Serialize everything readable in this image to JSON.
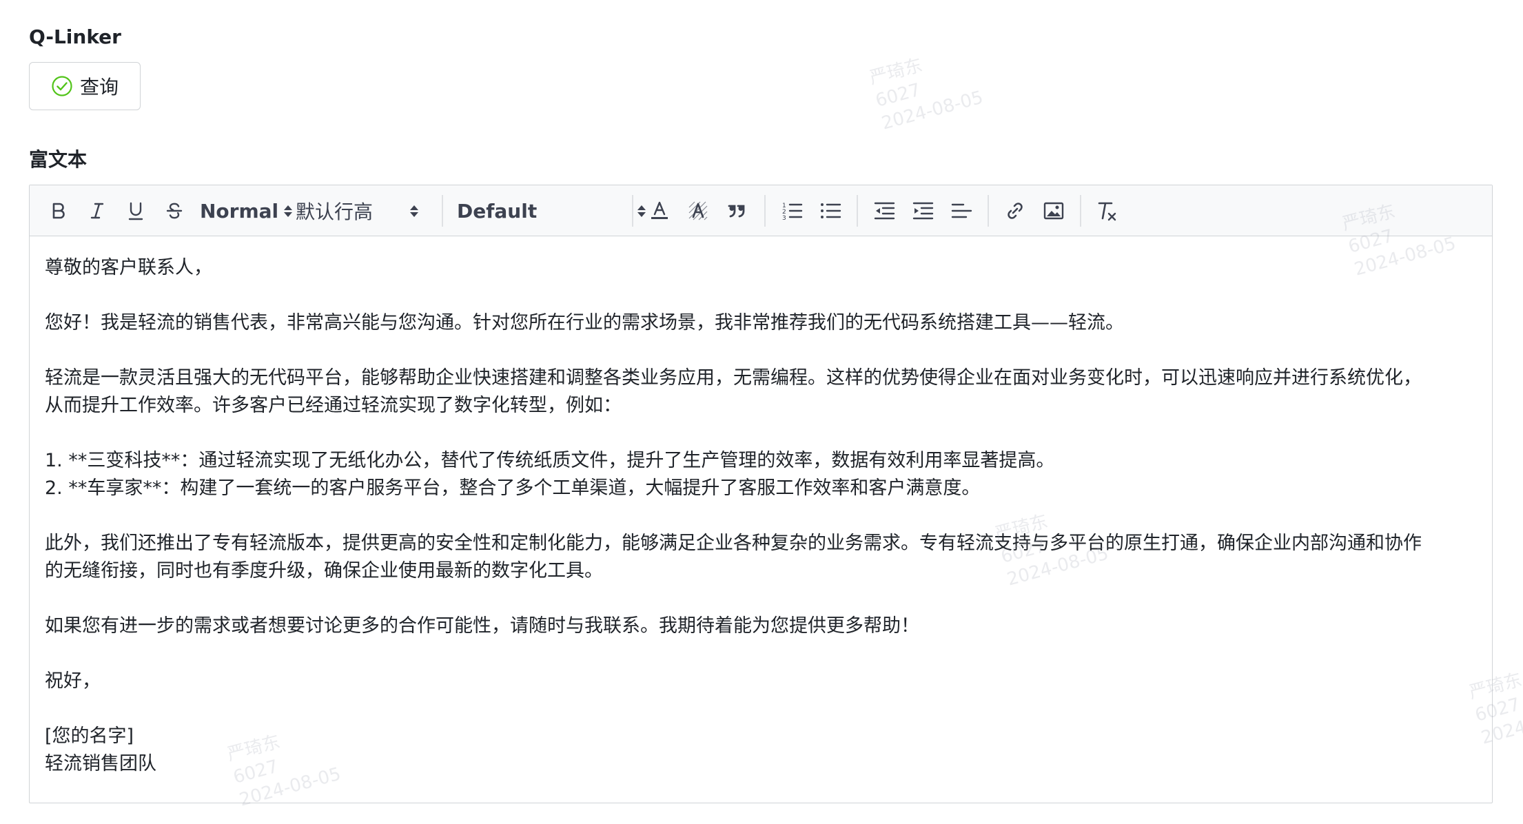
{
  "qlinker": {
    "label": "Q-Linker",
    "query_button_label": "查询"
  },
  "richtext": {
    "label": "富文本",
    "toolbar": {
      "header_select": "Normal",
      "line_height_select": "默认行高",
      "font_select": "Default"
    },
    "content": {
      "greeting": "尊敬的客户联系人，",
      "p1": "您好！我是轻流的销售代表，非常高兴能与您沟通。针对您所在行业的需求场景，我非常推荐我们的无代码系统搭建工具——轻流。",
      "p2_line1": "轻流是一款灵活且强大的无代码平台，能够帮助企业快速搭建和调整各类业务应用，无需编程。这样的优势使得企业在面对业务变化时，可以迅速响应并进行系统优化，",
      "p2_line2": "从而提升工作效率。许多客户已经通过轻流实现了数字化转型，例如：",
      "list_item1": "1. **三变科技**：通过轻流实现了无纸化办公，替代了传统纸质文件，提升了生产管理的效率，数据有效利用率显著提高。",
      "list_item2": "2. **车享家**：构建了一套统一的客户服务平台，整合了多个工单渠道，大幅提升了客服工作效率和客户满意度。",
      "p3_line1": "此外，我们还推出了专有轻流版本，提供更高的安全性和定制化能力，能够满足企业各种复杂的业务需求。专有轻流支持与多平台的原生打通，确保企业内部沟通和协作",
      "p3_line2": "的无缝衔接，同时也有季度升级，确保企业使用最新的数字化工具。",
      "p4": "如果您有进一步的需求或者想要讨论更多的合作可能性，请随时与我联系。我期待着能为您提供更多帮助！",
      "closing": "祝好，",
      "signature_name": "[您的名字]",
      "signature_team": "轻流销售团队"
    }
  },
  "watermark": {
    "name": "严琦东",
    "id": "6027",
    "date": "2024-08-05"
  },
  "colors": {
    "success_icon": "#52c41a",
    "border": "#d0d3d6",
    "toolbar_bg": "#f8f9fa",
    "text": "#1f2329"
  }
}
